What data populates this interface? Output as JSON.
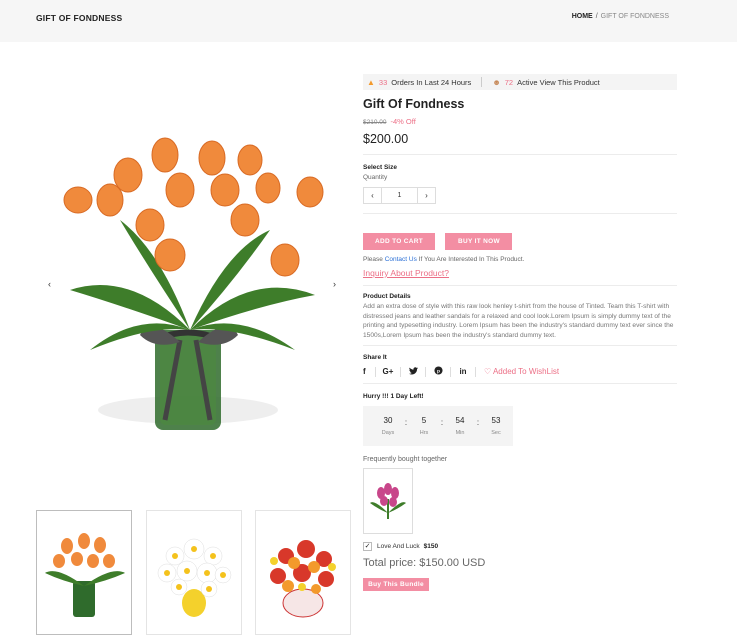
{
  "header": {
    "page_title": "GIFT OF FONDNESS",
    "breadcrumb_home": "HOME",
    "breadcrumb_sep": "/",
    "breadcrumb_current": "GIFT OF FONDNESS"
  },
  "gallery": {
    "prev": "‹",
    "next": "›"
  },
  "stats": {
    "orders_num": "33",
    "orders_label": "Orders In Last 24 Hours",
    "views_num": "72",
    "views_label": "Active View This Product"
  },
  "product": {
    "title": "Gift Of Fondness",
    "old_price": "$210.00",
    "discount": "-4% Off",
    "price": "$200.00",
    "select_size": "Select Size",
    "quantity_label": "Quantity",
    "qty_minus": "‹",
    "qty_value": "1",
    "qty_plus": "›",
    "add_to_cart": "ADD TO CART",
    "buy_now": "BUY IT NOW",
    "contact_prefix": "Please",
    "contact_link": "Contact Us",
    "contact_suffix": "If You Are Interested In This Product.",
    "inquiry": "Inquiry About Product?",
    "details_title": "Product Details",
    "details_text": "Add an extra dose of style with this raw look henley t-shirt from the house of Tinted. Team this T-shirt with distressed jeans and leather sandals for a relaxed and cool look.Lorem Ipsum is simply dummy text of the printing and typesetting industry. Lorem Ipsum has been the industry's standard dummy text ever since the 1500s,Lorem Ipsum has been the industry's standard dummy text."
  },
  "share": {
    "title": "Share It",
    "facebook": "f",
    "google": "G+",
    "twitter": "🐦",
    "pinterest": "℗",
    "linkedin": "in",
    "wishlist": "Added To WishList"
  },
  "countdown": {
    "title": "Hurry !!! 1 Day Left!",
    "days": "30",
    "days_label": "Days",
    "hrs": "5",
    "hrs_label": "Hrs",
    "min": "54",
    "min_label": "Min",
    "sec": "53",
    "sec_label": "Sec"
  },
  "bundle": {
    "title": "Frequently bought together",
    "item_name": "Love And Luck",
    "item_price": "$150",
    "total": "Total price: $150.00 USD",
    "button": "Buy This Bundle"
  },
  "colors": {
    "accent": "#f38ea3",
    "link": "#2a6fd6",
    "stat_highlight": "#ec6f86"
  }
}
